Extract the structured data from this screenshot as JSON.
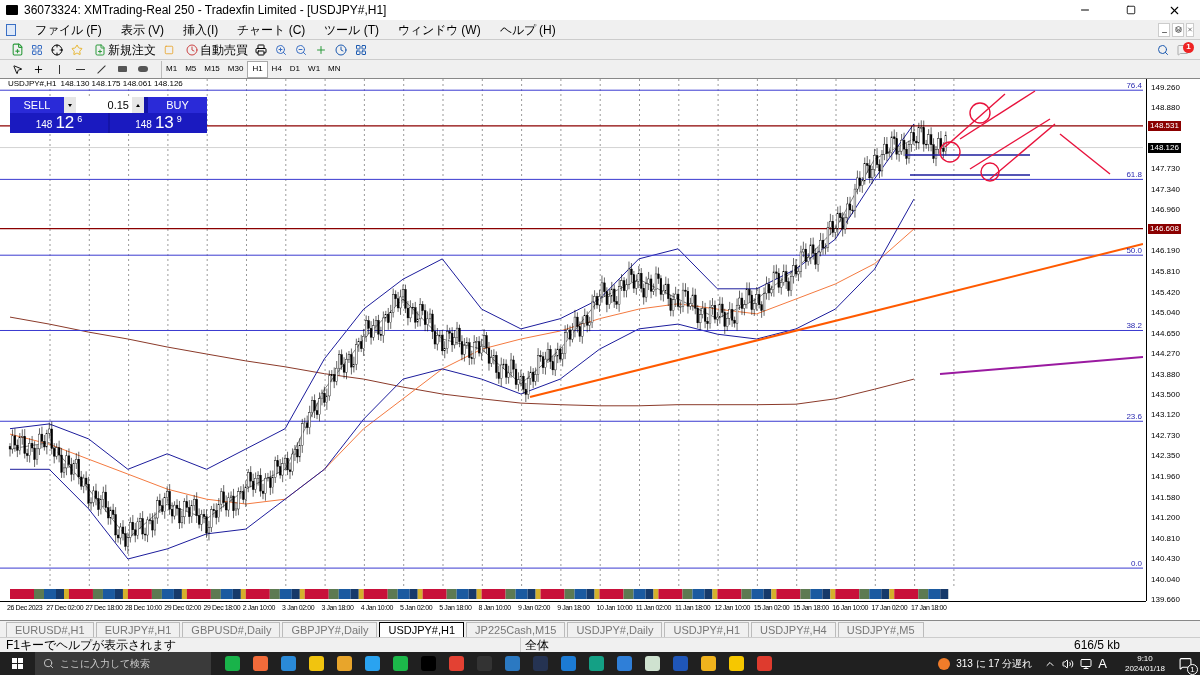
{
  "window": {
    "title": "36073324: XMTrading-Real 250 - Tradexfin Limited - [USDJPY#,H1]"
  },
  "menu": [
    "ファイル (F)",
    "表示 (V)",
    "挿入(I)",
    "チャート (C)",
    "ツール (T)",
    "ウィンドウ (W)",
    "ヘルプ (H)"
  ],
  "toolbar": {
    "new_order": "新規注文",
    "auto_trading": "自動売買",
    "notification_badge": "1"
  },
  "timeframes": [
    {
      "label": "M1",
      "selected": false
    },
    {
      "label": "M5",
      "selected": false
    },
    {
      "label": "M15",
      "selected": false
    },
    {
      "label": "M30",
      "selected": false
    },
    {
      "label": "H1",
      "selected": true
    },
    {
      "label": "H4",
      "selected": false
    },
    {
      "label": "D1",
      "selected": false
    },
    {
      "label": "W1",
      "selected": false
    },
    {
      "label": "MN",
      "selected": false
    }
  ],
  "chart": {
    "header": "148.130 148.175 148.061 148.126",
    "one_click": {
      "sell": "SELL",
      "buy": "BUY",
      "lots": "0.15",
      "sell_price": [
        "148",
        "12",
        "6"
      ],
      "buy_price": [
        "148",
        "13",
        "9"
      ]
    },
    "chart_data": {
      "type": "line",
      "categories": [
        "26 Dec 2023",
        "27 Dec 02:00",
        "27 Dec 18:00",
        "28 Dec 10:00",
        "29 Dec 02:00",
        "29 Dec 18:00",
        "2 Jan 10:00",
        "3 Jan 02:00",
        "3 Jan 18:00",
        "4 Jan 10:00",
        "5 Jan 02:00",
        "5 Jan 18:00",
        "8 Jan 10:00",
        "9 Jan 02:00",
        "9 Jan 18:00",
        "10 Jan 10:00",
        "11 Jan 02:00",
        "11 Jan 18:00",
        "12 Jan 10:00",
        "15 Jan 02:00",
        "15 Jan 18:00",
        "16 Jan 10:00",
        "17 Jan 02:00",
        "17 Jan 18:00"
      ],
      "series": [
        {
          "name": "USDJPY#,H1",
          "color": "#000000",
          "values": [
            142.48,
            142.6,
            141.73,
            140.8,
            141.45,
            141.17,
            141.73,
            142.1,
            143.6,
            144.54,
            145.29,
            144.54,
            144.35,
            143.7,
            144.35,
            145.29,
            145.66,
            145.29,
            144.92,
            145.29,
            145.85,
            146.6,
            147.91,
            148.29
          ]
        },
        {
          "color": "#8b3a2a",
          "values": [
            144.95,
            144.82,
            144.67,
            144.54,
            144.39,
            144.26,
            144.13,
            144.02,
            143.89,
            143.79,
            143.64,
            143.51,
            143.42,
            143.34,
            143.31,
            143.29,
            143.29,
            143.31,
            143.31,
            143.31,
            143.32,
            143.42,
            143.6,
            143.79
          ]
        },
        {
          "color": "#f47a40",
          "values": [
            142.76,
            142.57,
            142.29,
            142.01,
            141.73,
            141.54,
            141.45,
            141.54,
            142.1,
            142.86,
            143.42,
            143.98,
            144.35,
            144.54,
            144.69,
            144.92,
            145.1,
            145.2,
            145.1,
            145.01,
            145.29,
            145.57,
            145.95,
            146.6
          ]
        },
        {
          "color": "#1c1c9c",
          "values": [
            142.86,
            142.95,
            142.67,
            142.1,
            142.39,
            142.1,
            142.48,
            142.86,
            144.17,
            145.1,
            145.66,
            146.04,
            145.1,
            144.73,
            144.92,
            145.29,
            146.04,
            146.23,
            145.48,
            145.48,
            145.85,
            146.41,
            147.54,
            148.57
          ]
        },
        {
          "color": "#1c1c9c",
          "values": [
            142.1,
            142.1,
            141.36,
            140.42,
            140.61,
            140.89,
            140.98,
            141.54,
            142.1,
            143.04,
            143.79,
            143.98,
            143.79,
            143.51,
            143.79,
            144.35,
            144.73,
            144.82,
            144.63,
            144.54,
            144.73,
            145.1,
            145.85,
            147.16
          ]
        }
      ],
      "ylim": [
        139.66,
        149.41
      ],
      "yticks": [
        {
          "value": 149.26,
          "label": "149.260"
        },
        {
          "value": 148.88,
          "label": "148.880"
        },
        {
          "value": 147.73,
          "label": "147.730"
        },
        {
          "value": 147.34,
          "label": "147.340"
        },
        {
          "value": 146.96,
          "label": "146.960"
        },
        {
          "value": 146.19,
          "label": "146.190"
        },
        {
          "value": 145.81,
          "label": "145.810"
        },
        {
          "value": 145.42,
          "label": "145.420"
        },
        {
          "value": 145.04,
          "label": "145.040"
        },
        {
          "value": 144.65,
          "label": "144.650"
        },
        {
          "value": 144.27,
          "label": "144.270"
        },
        {
          "value": 143.88,
          "label": "143.880"
        },
        {
          "value": 143.5,
          "label": "143.500"
        },
        {
          "value": 143.12,
          "label": "143.120"
        },
        {
          "value": 142.73,
          "label": "142.730"
        },
        {
          "value": 142.35,
          "label": "142.350"
        },
        {
          "value": 141.96,
          "label": "141.960"
        },
        {
          "value": 141.58,
          "label": "141.580"
        },
        {
          "value": 141.2,
          "label": "141.200"
        },
        {
          "value": 140.81,
          "label": "140.810"
        },
        {
          "value": 140.43,
          "label": "140.430"
        },
        {
          "value": 140.04,
          "label": "140.040"
        },
        {
          "value": 139.66,
          "label": "139.660"
        }
      ],
      "grid": true
    },
    "price_tags": [
      {
        "label": "148.531",
        "kind": "level"
      },
      {
        "label": "148.126",
        "kind": "bid"
      },
      {
        "label": "146.608",
        "kind": "level"
      }
    ],
    "fibonacci": [
      {
        "label": "76.4"
      },
      {
        "label": "61.8"
      },
      {
        "label": "50.0"
      },
      {
        "label": "38.2"
      },
      {
        "label": "23.6"
      },
      {
        "label": "0.0"
      }
    ]
  },
  "tabs": [
    {
      "label": "EURUSD#,H1",
      "selected": false
    },
    {
      "label": "EURJPY#,H1",
      "selected": false
    },
    {
      "label": "GBPUSD#,Daily",
      "selected": false
    },
    {
      "label": "GBPJPY#,Daily",
      "selected": false
    },
    {
      "label": "USDJPY#,H1",
      "selected": true
    },
    {
      "label": "JP225Cash,M15",
      "selected": false
    },
    {
      "label": "USDJPY#,Daily",
      "selected": false
    },
    {
      "label": "USDJPY#,H1",
      "selected": false
    },
    {
      "label": "USDJPY#,H4",
      "selected": false
    },
    {
      "label": "USDJPY#,M5",
      "selected": false
    }
  ],
  "status_bar": {
    "help": "F1キーでヘルプが表示されます",
    "profile": "全体",
    "traffic": "616/5 kb"
  },
  "taskbar": {
    "search_placeholder": "ここに入力して検索",
    "traffic_notice": "313 に 17 分遅れ",
    "ime": "A",
    "time": "9:10",
    "date": "2024/01/18",
    "notifications": "1"
  }
}
